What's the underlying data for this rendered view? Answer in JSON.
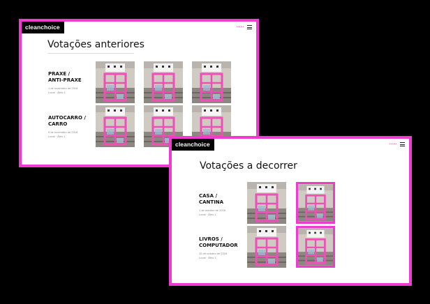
{
  "brand": {
    "logo": "cleanchoice",
    "accent": "#f03bd0",
    "dots": "••••"
  },
  "icons": {
    "menu": "hamburger-menu-icon",
    "dots": "dots-icon"
  },
  "previous": {
    "title": "Votações anteriores",
    "items": [
      {
        "label": "PRAXE /\nANTI-PRAXE",
        "date": "1 de novembro de 2018",
        "place": "Local · Átrio 1"
      },
      {
        "label": "AUTOCARRO /\nCARRO",
        "date": "5 de novembro de 2018",
        "place": "Local · Átrio 1"
      }
    ]
  },
  "current": {
    "title": "Votações a decorrer",
    "items": [
      {
        "label": "CASA /\nCANTINA",
        "date": "1 de outubro de 2018",
        "place": "Local · Átrio 1"
      },
      {
        "label": "LIVROS /\nCOMPUTADOR",
        "date": "15 de outubro de 2018",
        "place": "Local · Átrio 1"
      }
    ]
  }
}
